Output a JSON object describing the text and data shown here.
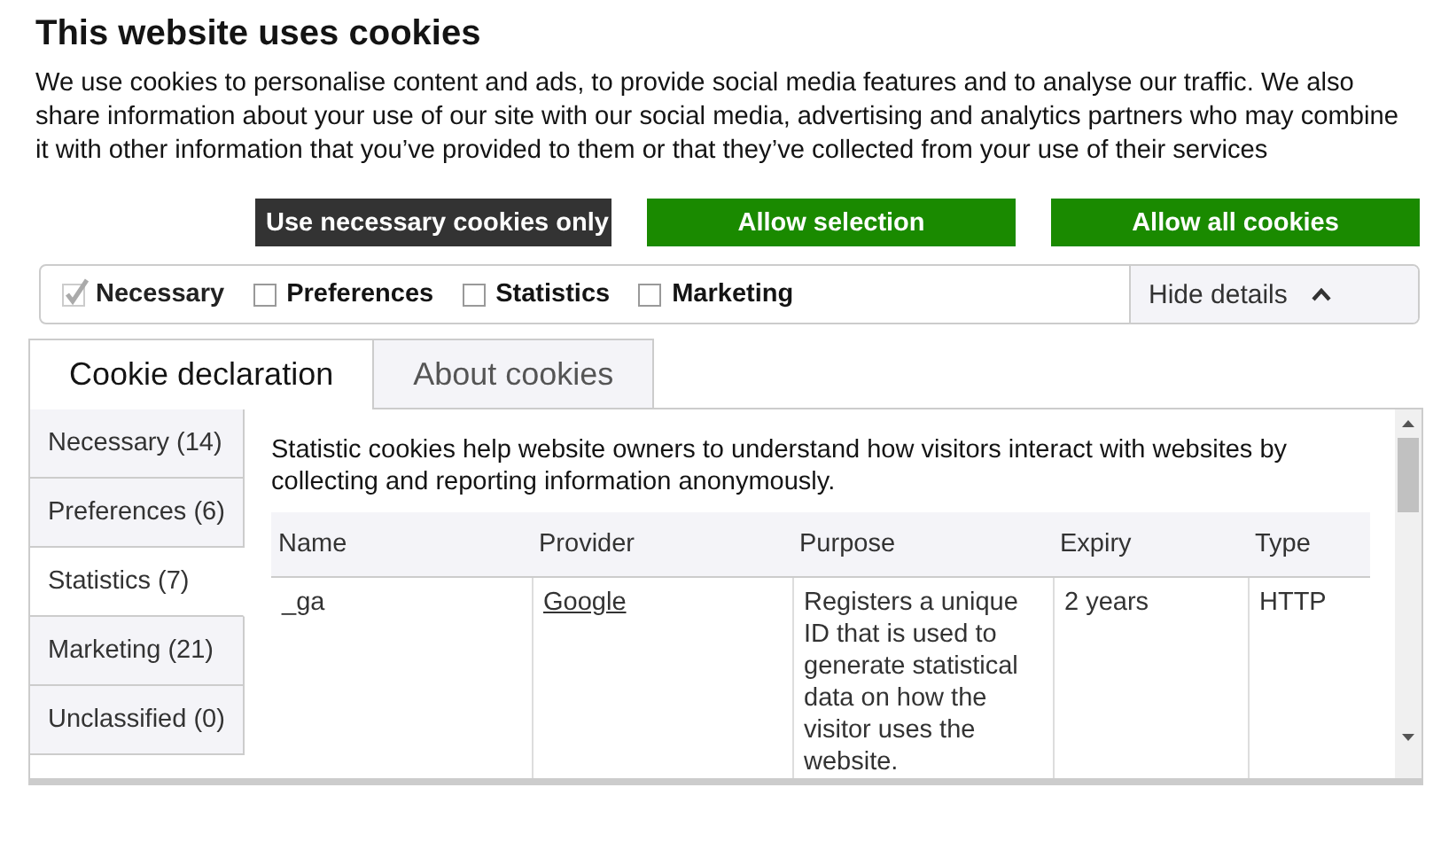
{
  "title": "This website uses cookies",
  "description": "We use cookies to personalise content and ads, to provide social media features and to analyse our traffic. We also share information about your use of our site with our social media, advertising and analytics partners who may combine it with other information that you’ve provided to them or that they’ve collected from your use of their services",
  "buttons": [
    {
      "label": "Use necessary cookies only",
      "kind": "dark"
    },
    {
      "label": "Allow selection",
      "kind": "green"
    },
    {
      "label": "Allow all cookies",
      "kind": "green"
    }
  ],
  "consent": [
    {
      "label": "Necessary",
      "checked": true,
      "disabled": true
    },
    {
      "label": "Preferences",
      "checked": false,
      "disabled": false
    },
    {
      "label": "Statistics",
      "checked": false,
      "disabled": false
    },
    {
      "label": "Marketing",
      "checked": false,
      "disabled": false
    }
  ],
  "details_toggle": {
    "label": "Hide details",
    "expanded": true
  },
  "tabs": [
    {
      "label": "Cookie declaration",
      "selected": true
    },
    {
      "label": "About cookies",
      "selected": false
    }
  ],
  "categories": [
    {
      "label": "Necessary (14)",
      "selected": false
    },
    {
      "label": "Preferences (6)",
      "selected": false
    },
    {
      "label": "Statistics (7)",
      "selected": true
    },
    {
      "label": "Marketing (21)",
      "selected": false
    },
    {
      "label": "Unclassified (0)",
      "selected": false
    }
  ],
  "category_description": "Statistic cookies help website owners to understand how visitors interact with websites by collecting and reporting information anonymously.",
  "table": {
    "columns": [
      "Name",
      "Provider",
      "Purpose",
      "Expiry",
      "Type"
    ],
    "rows": [
      {
        "name": "_ga",
        "provider": "Google",
        "purpose": "Registers a unique ID that is used to generate statistical data on how the visitor uses the website.",
        "expiry": "2 years",
        "type": "HTTP"
      }
    ]
  }
}
